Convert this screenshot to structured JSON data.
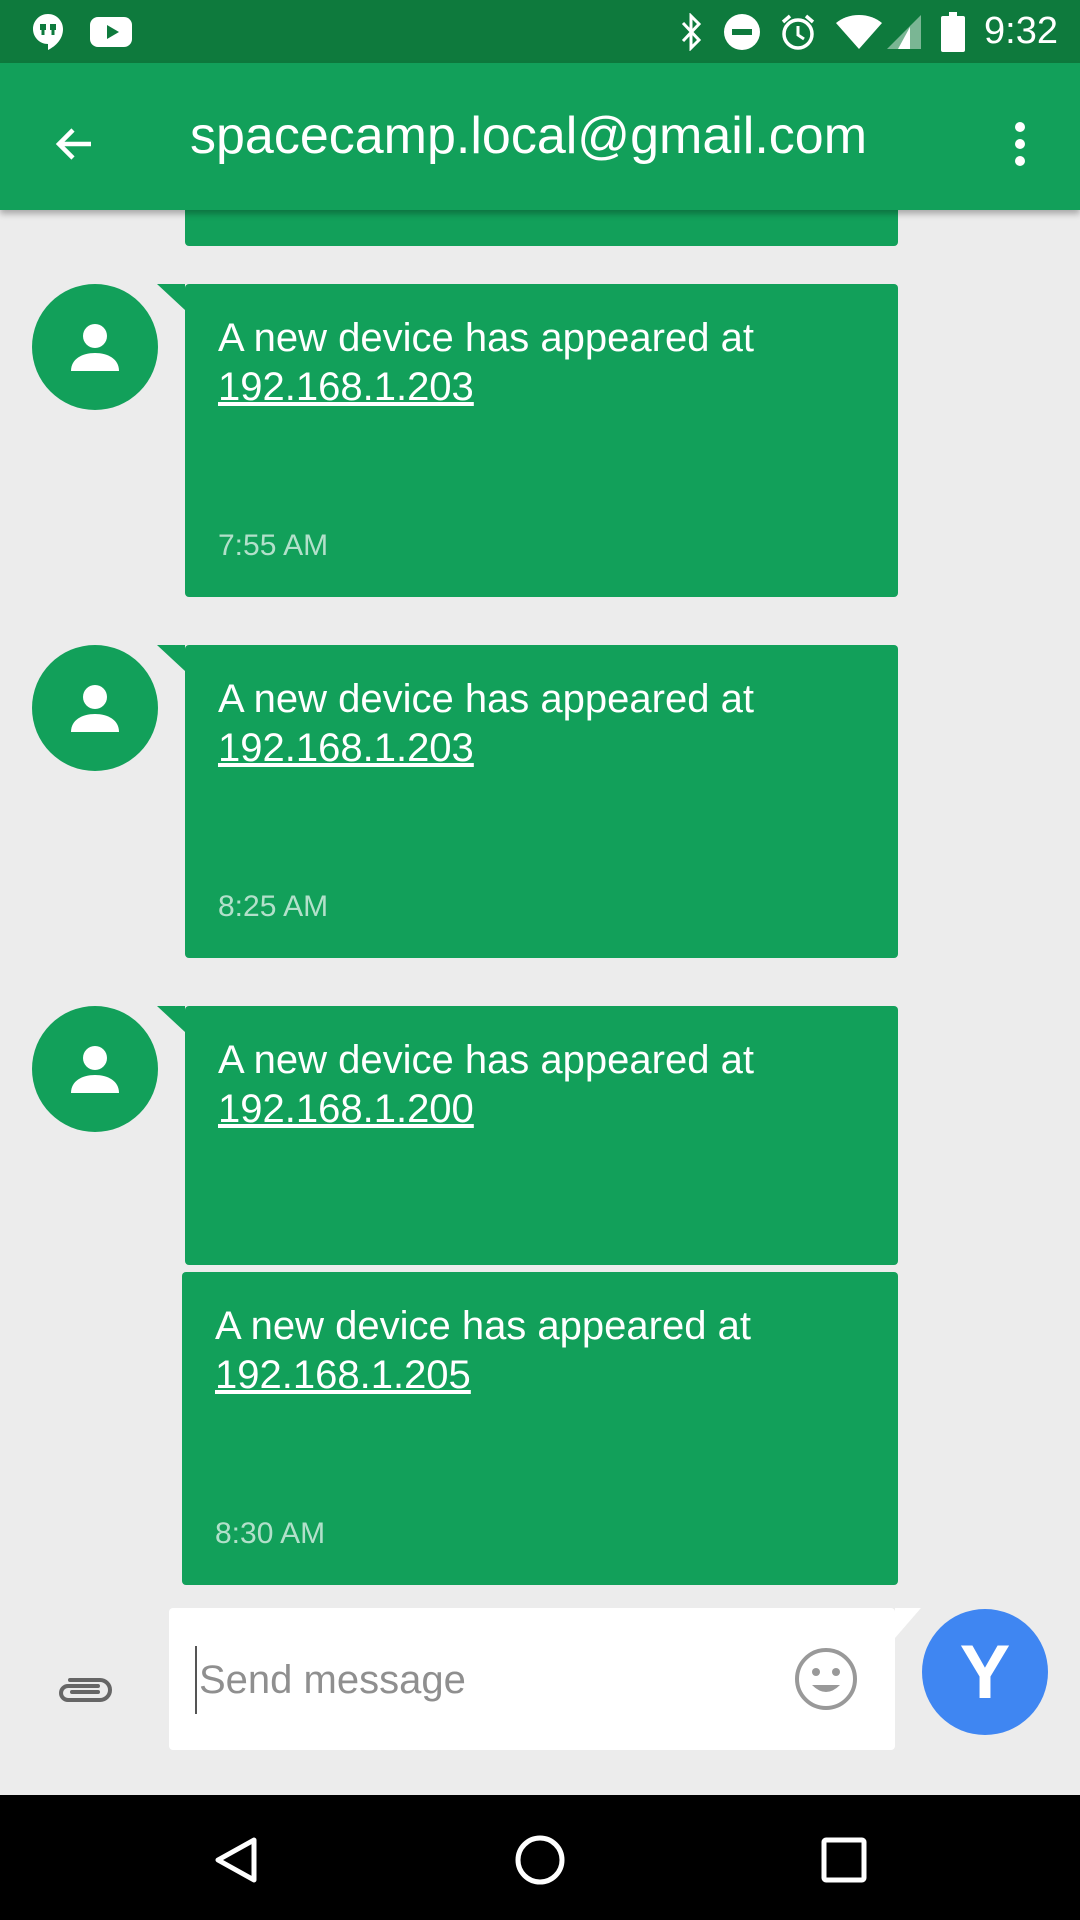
{
  "status_bar": {
    "time": "9:32",
    "left_icons": [
      "hangouts-icon",
      "youtube-icon"
    ],
    "right_icons": [
      "bluetooth-icon",
      "do-not-disturb-icon",
      "alarm-icon",
      "wifi-icon",
      "cellular-signal-icon",
      "battery-icon"
    ]
  },
  "app_bar": {
    "title": "spacecamp.local@gmail.com",
    "back_icon": "arrow-back-icon",
    "menu_icon": "more-vert-icon",
    "color": "#12a05a",
    "status_color": "#0e7a3d"
  },
  "messages": [
    {
      "text": "A new device has appeared at",
      "link": "192.168.1.203",
      "time": "7:55 AM"
    },
    {
      "text": "A new device has appeared at",
      "link": "192.168.1.203",
      "time": "8:25 AM"
    },
    {
      "text": "A new device has appeared at",
      "link": "192.168.1.200",
      "time": ""
    },
    {
      "text": "A new device has appeared at",
      "link": "192.168.1.205",
      "time": "8:30 AM"
    }
  ],
  "compose": {
    "placeholder": "Send message",
    "attach_icon": "paperclip-icon",
    "emoji_icon": "emoji-icon",
    "sender_initial": "Y",
    "sender_color": "#3f86f2"
  },
  "nav_bar": {
    "icons": [
      "back-triangle-icon",
      "home-circle-icon",
      "recents-square-icon"
    ]
  }
}
